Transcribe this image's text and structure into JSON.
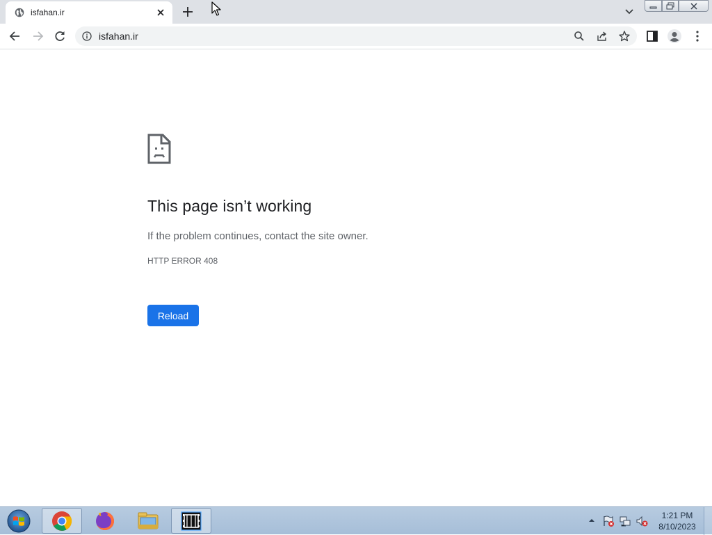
{
  "tab": {
    "title": "isfahan.ir"
  },
  "toolbar": {
    "url": "isfahan.ir"
  },
  "error": {
    "title": "This page isn’t working",
    "description": "If the problem continues, contact the site owner.",
    "code": "HTTP ERROR 408",
    "reload_label": "Reload"
  },
  "taskbar": {
    "apps": [
      "chrome-icon",
      "firefox-icon",
      "file-explorer-icon",
      "media-app-icon"
    ],
    "clock_time": "1:21 PM",
    "clock_date": "8/10/2023"
  },
  "colors": {
    "accent": "#1a73e8",
    "tabstrip": "#dee1e6",
    "taskbar": "#b7cbe0"
  }
}
